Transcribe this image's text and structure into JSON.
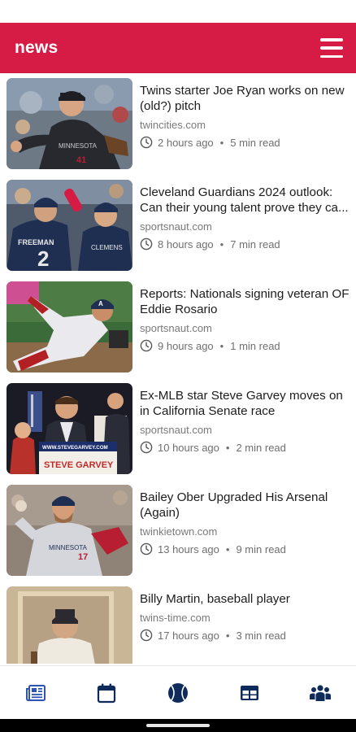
{
  "app": {
    "title": "news",
    "accent_color": "#d61c44",
    "nav_color": "#0f2b5c"
  },
  "articles": [
    {
      "headline": "Twins starter Joe Ryan works on new (old?) pitch",
      "source": "twincities.com",
      "time": "2 hours ago",
      "read": "5 min read"
    },
    {
      "headline": "Cleveland Guardians 2024 outlook: Can their young talent prove they ca...",
      "source": "sportsnaut.com",
      "time": "8 hours ago",
      "read": "7 min read"
    },
    {
      "headline": "Reports: Nationals signing veteran OF Eddie Rosario",
      "source": "sportsnaut.com",
      "time": "9 hours ago",
      "read": "1 min read"
    },
    {
      "headline": "Ex-MLB star Steve Garvey moves on in California Senate race",
      "source": "sportsnaut.com",
      "time": "10 hours ago",
      "read": "2 min read"
    },
    {
      "headline": "Bailey Ober Upgraded His Arsenal (Again)",
      "source": "twinkietown.com",
      "time": "13 hours ago",
      "read": "9 min read"
    },
    {
      "headline": "Billy Martin, baseball player",
      "source": "twins-time.com",
      "time": "17 hours ago",
      "read": "3 min read"
    }
  ],
  "thumbnail_text": {
    "a1_jersey": "MINNESOTA",
    "a2_jersey_left": "FREEMAN",
    "a2_number": "2",
    "a3_cap": "A",
    "a4_banner": "WWW.STEVEGARVEY.COM",
    "a4_sign": "STEVE GARVEY",
    "a5_jersey": "MINNESOTA",
    "a5_number": "17"
  },
  "separator": "•",
  "bottom_nav": [
    {
      "name": "news",
      "icon": "newspaper-icon",
      "active": true
    },
    {
      "name": "schedule",
      "icon": "calendar-icon",
      "active": false
    },
    {
      "name": "scores",
      "icon": "baseball-icon",
      "active": false
    },
    {
      "name": "standings",
      "icon": "table-icon",
      "active": false
    },
    {
      "name": "roster",
      "icon": "team-icon",
      "active": false
    }
  ]
}
